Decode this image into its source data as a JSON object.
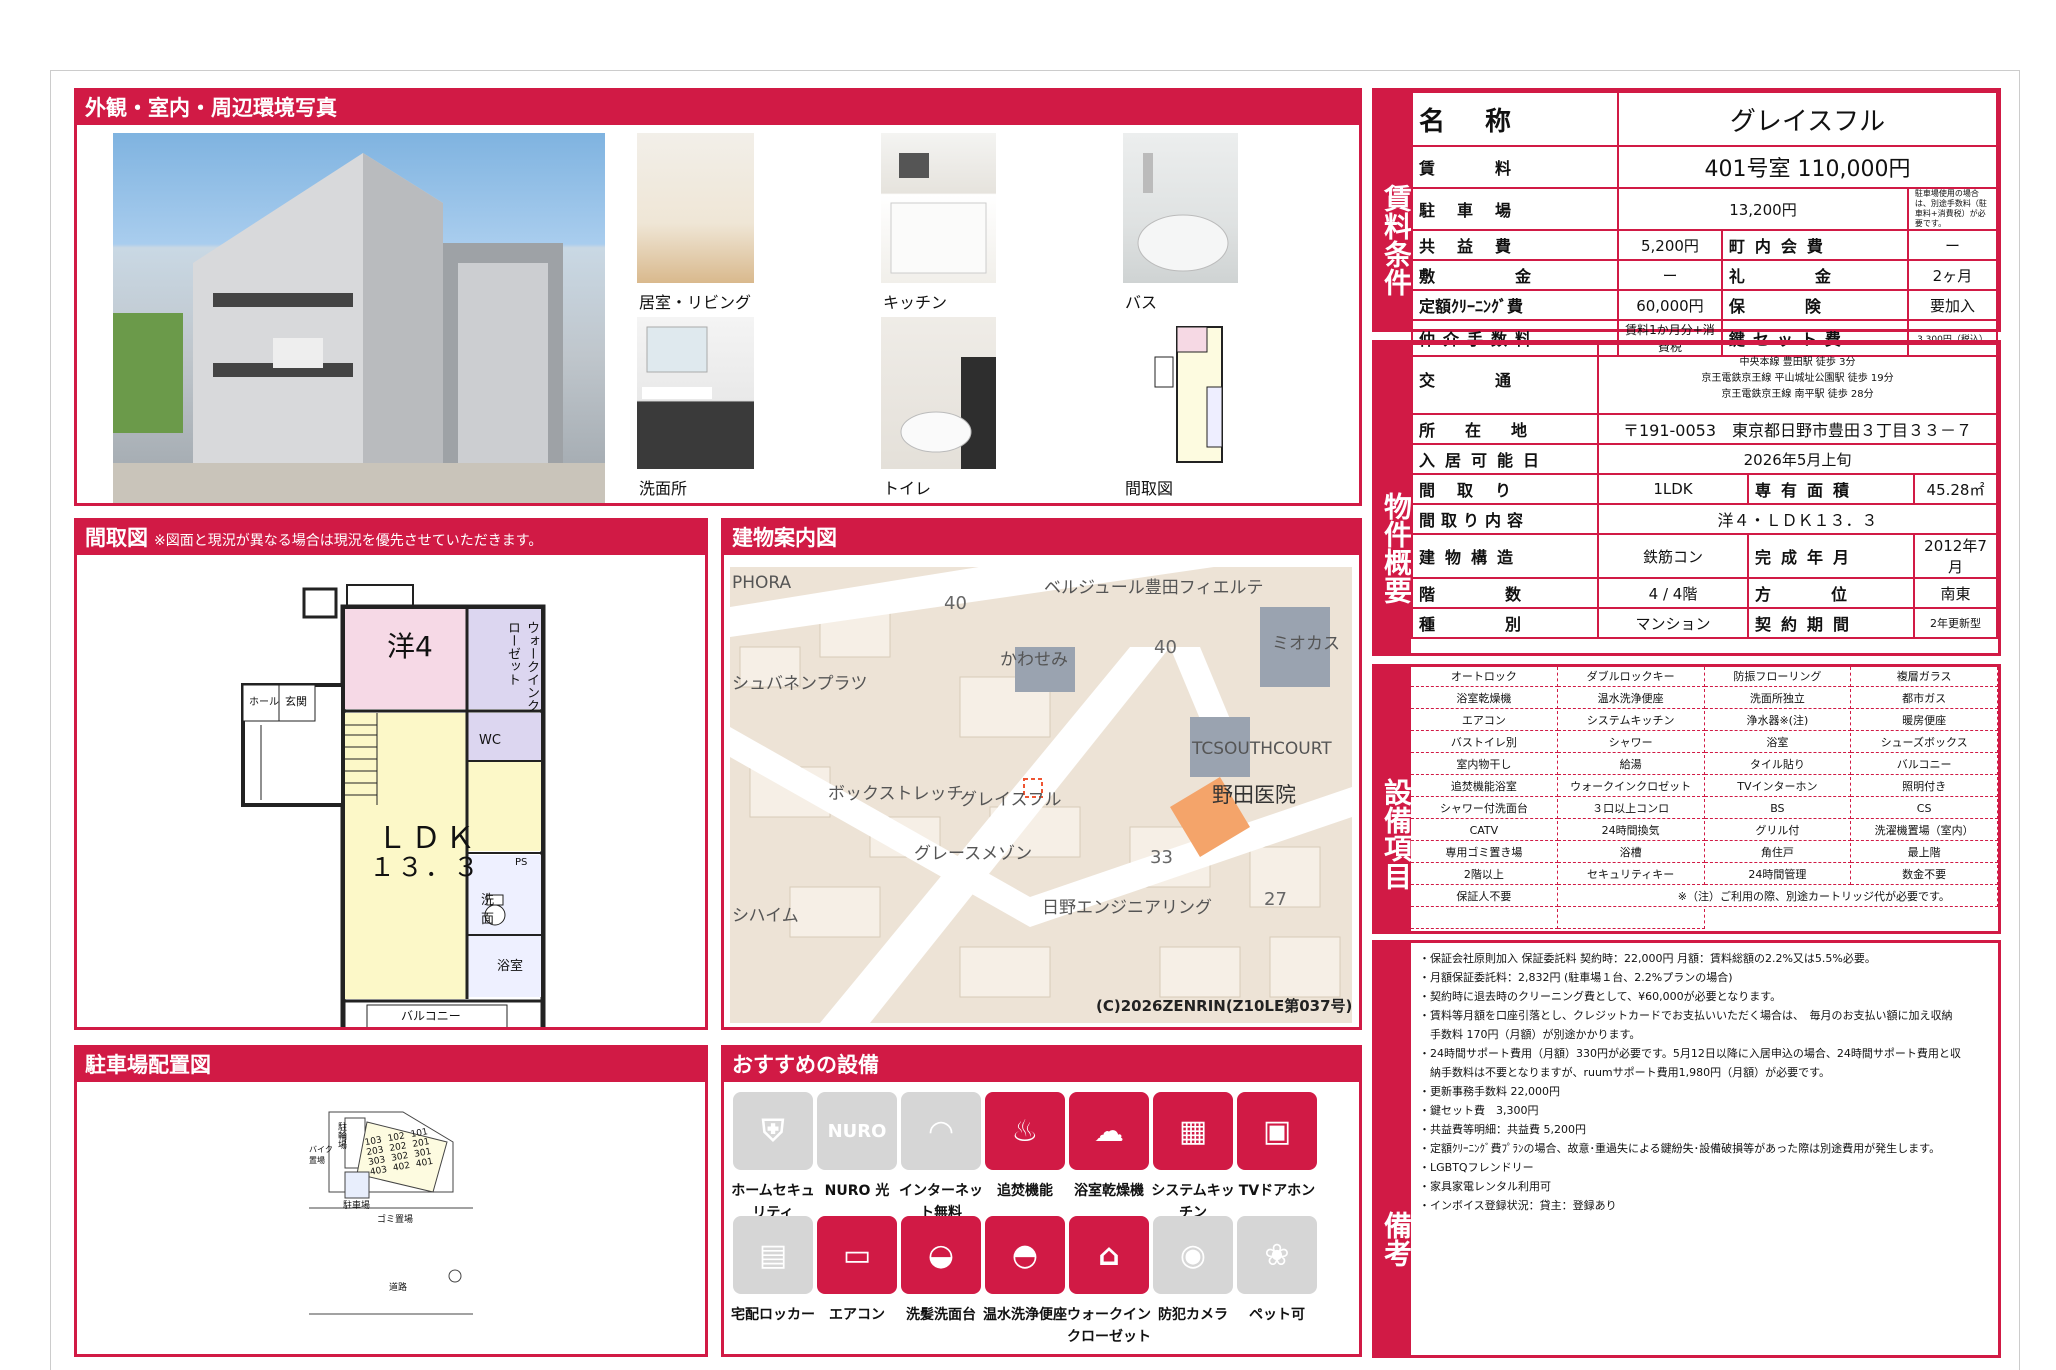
{
  "photos_panel": {
    "title": "外観・室内・周辺環境写真",
    "captions": [
      "居室・リビング",
      "キッチン",
      "バス",
      "洗面所",
      "トイレ",
      "間取図"
    ]
  },
  "floorplan_panel": {
    "title": "間取図",
    "note": "※図面と現況が異なる場合は現況を優先させていただきます。",
    "labels": {
      "room": "洋4",
      "closet": "ウォークインクローゼット",
      "wc": "WC",
      "ldk": "ＬＤＫ",
      "ldk_size": "１３．３",
      "hall": "ホール",
      "entrance": "玄関",
      "wash": "洗面",
      "bath": "浴室",
      "balcony": "バルコニー",
      "ps": "PS"
    }
  },
  "map_panel": {
    "title": "建物案内図",
    "labels": [
      "PHORA",
      "40",
      "ベルジュール豊田フィエルテ",
      "かわせみ",
      "40",
      "ミオカス",
      "シュバネンプラツ",
      "TCSOUTHCOURT",
      "ボックストレッチ",
      "グレイスフル",
      "野田医院",
      "グレースメゾン",
      "33",
      "シハイム",
      "日野エンジニアリング",
      "27"
    ],
    "copyright": "(C)2026ZENRIN(Z10LE第037号)"
  },
  "parking_panel": {
    "title": "駐車場配置図",
    "labels": {
      "bike": "駐輪場",
      "bike2": "バイク置場",
      "parking": "駐車場",
      "garbage": "ゴミ置場",
      "road": "道路",
      "rooms": [
        "103",
        "102",
        "101",
        "203",
        "202",
        "201",
        "303",
        "302",
        "301",
        "403",
        "402",
        "401"
      ]
    }
  },
  "recommend_panel": {
    "title": "おすすめの設備",
    "items": [
      {
        "label": "ホームセキュリティ",
        "icon": "shield-icon",
        "on": false
      },
      {
        "label": "NURO 光",
        "icon": "nuro-icon",
        "on": false
      },
      {
        "label": "インターネット無料",
        "icon": "wifi-icon",
        "on": false
      },
      {
        "label": "追焚機能",
        "icon": "bathtub-icon",
        "on": true
      },
      {
        "label": "浴室乾燥機",
        "icon": "bath-dryer-icon",
        "on": true
      },
      {
        "label": "システムキッチン",
        "icon": "kitchen-icon",
        "on": true
      },
      {
        "label": "TVドアホン",
        "icon": "intercom-icon",
        "on": true
      },
      {
        "label": "宅配ロッカー",
        "icon": "locker-icon",
        "on": false
      },
      {
        "label": "エアコン",
        "icon": "aircon-icon",
        "on": true
      },
      {
        "label": "洗髪洗面台",
        "icon": "washbasin-icon",
        "on": true
      },
      {
        "label": "温水洗浄便座",
        "icon": "toilet-icon",
        "on": true
      },
      {
        "label": "ウォークインクローゼット",
        "icon": "closet-icon",
        "on": true
      },
      {
        "label": "防犯カメラ",
        "icon": "camera-icon",
        "on": false
      },
      {
        "label": "ペット可",
        "icon": "paw-icon",
        "on": false
      }
    ]
  },
  "rent": {
    "vlabel": "賃料条件",
    "name_label": "名称",
    "name": "グレイスフル",
    "rent_label": "賃料",
    "rent": "401号室 110,000円",
    "parking_label": "駐車場",
    "parking": "13,200円",
    "parking_note": "駐車場使用の場合は、別途手数料（駐車料+消費税）が必要です。",
    "common_label": "共益費",
    "common": "5,200円",
    "town_label": "町内会費",
    "town": "ー",
    "deposit_label": "敷金",
    "deposit": "ー",
    "key_money_label": "礼金",
    "key_money": "2ヶ月",
    "cleaning_label": "定額ｸﾘｰﾆﾝｸﾞ費",
    "cleaning": "60,000円",
    "insurance_label": "保険",
    "insurance": "要加入",
    "agent_label": "仲介手数料",
    "agent": "賃料1か月分+消費税",
    "keyset_label": "鍵セット費",
    "keyset": "3,300円（税込）"
  },
  "property": {
    "vlabel": "物件概要",
    "traffic_label": "交通",
    "traffic": [
      "中央本線 豊田駅 徒歩 3分",
      "京王電鉄京王線 平山城址公園駅 徒歩 19分",
      "京王電鉄京王線 南平駅 徒歩 28分"
    ],
    "address_label": "所在地",
    "address": "〒191-0053　東京都日野市豊田３丁目３３－７",
    "move_label": "入居可能日",
    "move": "2026年5月上旬",
    "layout_label": "間取り",
    "layout": "1LDK",
    "area_label": "専有面積",
    "area": "45.28㎡",
    "detail_label": "間取り内容",
    "detail": "洋４・ＬＤＫ１３．３",
    "structure_label": "建物構造",
    "structure": "鉄筋コン",
    "built_label": "完成年月",
    "built": "2012年7月",
    "floor_label": "階数",
    "floor": "4 / 4階",
    "direction_label": "方位",
    "direction": "南東",
    "type_label": "種別",
    "type": "マンション",
    "contract_label": "契約期間",
    "contract": "2年更新型"
  },
  "equipment": {
    "vlabel": "設備項目",
    "items": [
      "オートロック",
      "ダブルロックキー",
      "防振フローリング",
      "複層ガラス",
      "浴室乾燥機",
      "温水洗浄便座",
      "洗面所独立",
      "都市ガス",
      "エアコン",
      "システムキッチン",
      "浄水器※(注)",
      "暖房便座",
      "バストイレ別",
      "シャワー",
      "浴室",
      "シューズボックス",
      "室内物干し",
      "給湯",
      "タイル貼り",
      "バルコニー",
      "追焚機能浴室",
      "ウォークインクロゼット",
      "TVインターホン",
      "照明付き",
      "シャワー付洗面台",
      "３口以上コンロ",
      "BS",
      "CS",
      "CATV",
      "24時間換気",
      "グリル付",
      "洗濯機置場（室内）",
      "専用ゴミ置き場",
      "浴槽",
      "角住戸",
      "最上階",
      "2階以上",
      "セキュリティキー",
      "24時間管理",
      "数金不要",
      "保証人不要",
      "※（注）ご利用の際、別途カートリッジ代が必要です。",
      "",
      ""
    ]
  },
  "remarks": {
    "vlabel": "備考",
    "lines": [
      "・保証会社原則加入 保証委託料 契約時：22,000円 月額：賃料総額の2.2%又は5.5%必要。",
      "・月額保証委託料：2,832円 (駐車場１台、2.2%プランの場合)",
      "・契約時に退去時のクリーニング費として、¥60,000が必要となります。",
      "・賃料等月額を口座引落とし、クレジットカードでお支払いいただく場合は、　毎月のお支払い額に加え収納",
      "　手数料 170円（月額）が別途かかります。",
      "・24時間サポート費用（月額）330円が必要です。5月12日以降に入居申込の場合、24時間サポート費用と収",
      "　納手数料は不要となりますが、ruumサポート費用1,980円（月額）が必要です。",
      "・更新事務手数料 22,000円",
      "・鍵セット費　3,300円",
      "・共益費等明細：共益費 5,200円",
      "・定額ｸﾘｰﾆﾝｸﾞ費ﾌﾟﾗﾝの場合、故意･重過失による鍵紛失･設備破損等があった際は別途費用が発生します。",
      "・LGBTQフレンドリー",
      "・家具家電レンタル利用可",
      "・インボイス登録状況：貸主：登録あり"
    ]
  },
  "colors": {
    "accent": "#d11a45",
    "tile_off": "#d6d6d6"
  }
}
